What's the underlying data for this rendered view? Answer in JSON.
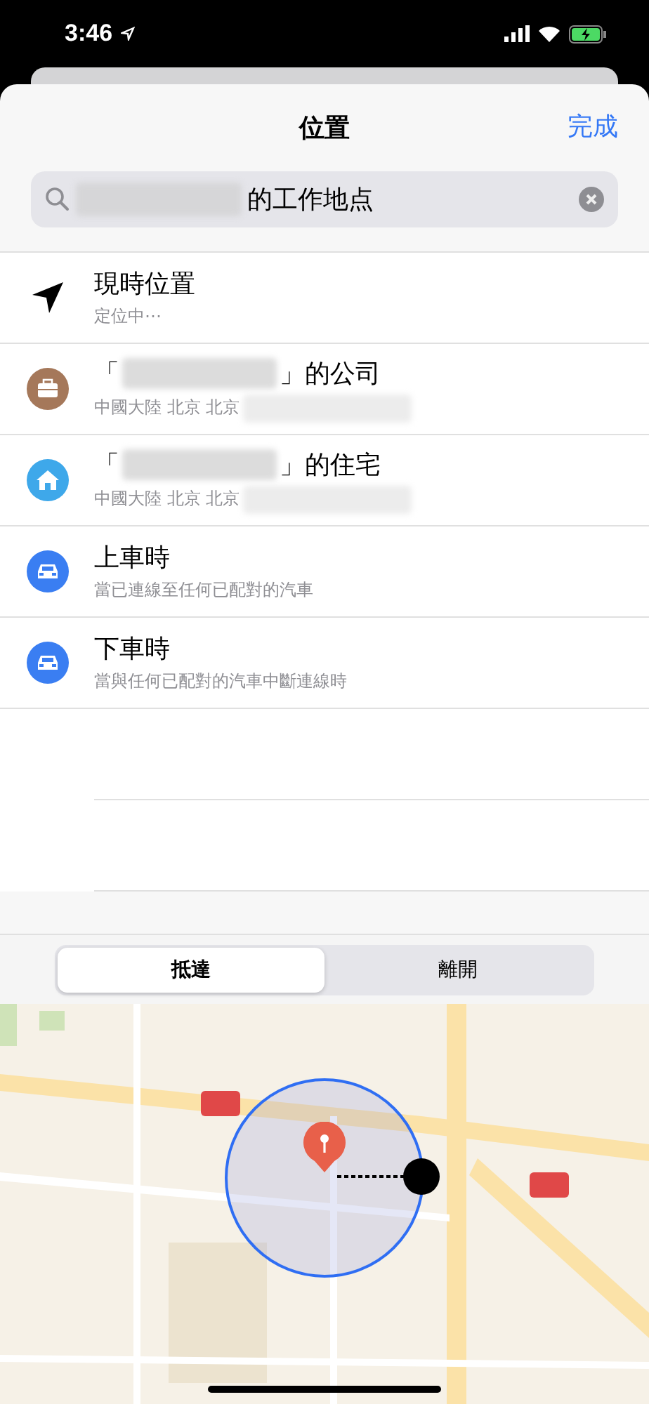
{
  "status_bar": {
    "time": "3:46"
  },
  "header": {
    "title": "位置",
    "done": "完成"
  },
  "search": {
    "redacted": true,
    "value": "的工作地点"
  },
  "rows": [
    {
      "kind": "location",
      "title_before": "現時位置",
      "title_redacted": false,
      "title_after": "",
      "subtitle": "定位中⋯",
      "subtitle_redacted": false
    },
    {
      "kind": "work",
      "title_before": "「",
      "title_redacted": true,
      "title_after": "」的公司",
      "subtitle": "中國大陸 北京 北京",
      "subtitle_redacted": true
    },
    {
      "kind": "home",
      "title_before": "「",
      "title_redacted": true,
      "title_after": "」的住宅",
      "subtitle": "中國大陸 北京 北京",
      "subtitle_redacted": true
    },
    {
      "kind": "car",
      "title_before": "上車時",
      "title_redacted": false,
      "title_after": "",
      "subtitle": "當已連線至任何已配對的汽車",
      "subtitle_redacted": false
    },
    {
      "kind": "car",
      "title_before": "下車時",
      "title_redacted": false,
      "title_after": "",
      "subtitle": "當與任何已配對的汽車中斷連線時",
      "subtitle_redacted": false
    }
  ],
  "segments": [
    {
      "label": "抵達",
      "selected": true
    },
    {
      "label": "離開",
      "selected": false
    }
  ]
}
